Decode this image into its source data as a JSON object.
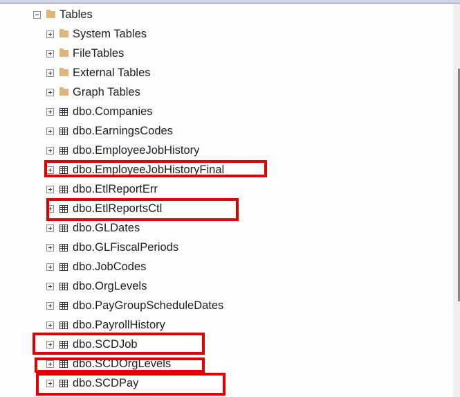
{
  "tree": {
    "root": {
      "label": "Tables",
      "icon": "folder-icon",
      "expanded": true
    },
    "folders": [
      {
        "label": "System Tables",
        "icon": "folder-icon"
      },
      {
        "label": "FileTables",
        "icon": "folder-icon"
      },
      {
        "label": "External Tables",
        "icon": "folder-icon"
      },
      {
        "label": "Graph Tables",
        "icon": "folder-icon"
      }
    ],
    "tables": [
      {
        "label": "dbo.Companies",
        "highlighted": false
      },
      {
        "label": "dbo.EarningsCodes",
        "highlighted": false
      },
      {
        "label": "dbo.EmployeeJobHistory",
        "highlighted": false
      },
      {
        "label": "dbo.EmployeeJobHistoryFinal",
        "highlighted": true
      },
      {
        "label": "dbo.EtlReportErr",
        "highlighted": false
      },
      {
        "label": "dbo.EtlReportsCtl",
        "highlighted": true
      },
      {
        "label": "dbo.GLDates",
        "highlighted": false
      },
      {
        "label": "dbo.GLFiscalPeriods",
        "highlighted": false
      },
      {
        "label": "dbo.JobCodes",
        "highlighted": false
      },
      {
        "label": "dbo.OrgLevels",
        "highlighted": false
      },
      {
        "label": "dbo.PayGroupScheduleDates",
        "highlighted": false
      },
      {
        "label": "dbo.PayrollHistory",
        "highlighted": false
      },
      {
        "label": "dbo.SCDJob",
        "highlighted": true
      },
      {
        "label": "dbo.SCDOrgLevels",
        "highlighted": true
      },
      {
        "label": "dbo.SCDPay",
        "highlighted": true
      }
    ]
  },
  "colors": {
    "highlight_box": "#e00000",
    "folder": "#dcb67a"
  }
}
